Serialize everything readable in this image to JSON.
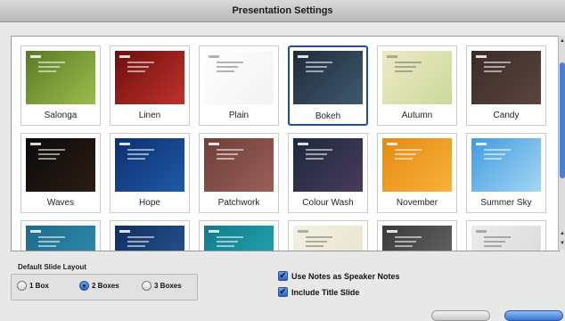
{
  "window": {
    "title": "Presentation Settings"
  },
  "themes": [
    {
      "name": "Salonga",
      "colors": [
        "#5a7a24",
        "#9bbd4b"
      ],
      "selected": false,
      "light": false
    },
    {
      "name": "Linen",
      "colors": [
        "#6b0f0f",
        "#c1312a"
      ],
      "selected": false,
      "light": false
    },
    {
      "name": "Plain",
      "colors": [
        "#ffffff",
        "#f2f2f2"
      ],
      "selected": false,
      "light": true
    },
    {
      "name": "Bokeh",
      "colors": [
        "#1f2b3a",
        "#3e5a6e"
      ],
      "selected": true,
      "light": false
    },
    {
      "name": "Autumn",
      "colors": [
        "#efe9c6",
        "#c9d99a"
      ],
      "selected": false,
      "light": true
    },
    {
      "name": "Candy",
      "colors": [
        "#3a2a26",
        "#5b4640"
      ],
      "selected": false,
      "light": false
    },
    {
      "name": "Waves",
      "colors": [
        "#0a0a0a",
        "#2b1d14"
      ],
      "selected": false,
      "light": false
    },
    {
      "name": "Hope",
      "colors": [
        "#0c2f6e",
        "#1f5aa8"
      ],
      "selected": false,
      "light": false
    },
    {
      "name": "Patchwork",
      "colors": [
        "#6e3f3a",
        "#9a5f58"
      ],
      "selected": false,
      "light": false
    },
    {
      "name": "Colour Wash",
      "colors": [
        "#1c2a3c",
        "#4a3a5c"
      ],
      "selected": false,
      "light": false
    },
    {
      "name": "November",
      "colors": [
        "#e58a12",
        "#f6b23c"
      ],
      "selected": false,
      "light": false
    },
    {
      "name": "Summer Sky",
      "colors": [
        "#3f9be0",
        "#a6d6f5"
      ],
      "selected": false,
      "light": false
    },
    {
      "name": "",
      "colors": [
        "#1d6a8a",
        "#2f91b0"
      ],
      "selected": false,
      "light": false
    },
    {
      "name": "",
      "colors": [
        "#0f2f5e",
        "#2a5a9a"
      ],
      "selected": false,
      "light": false
    },
    {
      "name": "",
      "colors": [
        "#127a8a",
        "#25a9b5"
      ],
      "selected": false,
      "light": false
    },
    {
      "name": "",
      "colors": [
        "#f3f1e4",
        "#e6e2c9"
      ],
      "selected": false,
      "light": true
    },
    {
      "name": "",
      "colors": [
        "#3a3a3a",
        "#6a6a6a"
      ],
      "selected": false,
      "light": false
    },
    {
      "name": "",
      "colors": [
        "#ececec",
        "#d8d8d8"
      ],
      "selected": false,
      "light": true
    }
  ],
  "layout": {
    "title": "Default Slide Layout",
    "options": [
      {
        "label": "1 Box",
        "selected": false
      },
      {
        "label": "2 Boxes",
        "selected": true
      },
      {
        "label": "3 Boxes",
        "selected": false
      }
    ]
  },
  "options": {
    "speaker_notes_label": "Use Notes as Speaker Notes",
    "speaker_notes_checked": true,
    "title_slide_label": "Include Title Slide",
    "title_slide_checked": true
  }
}
